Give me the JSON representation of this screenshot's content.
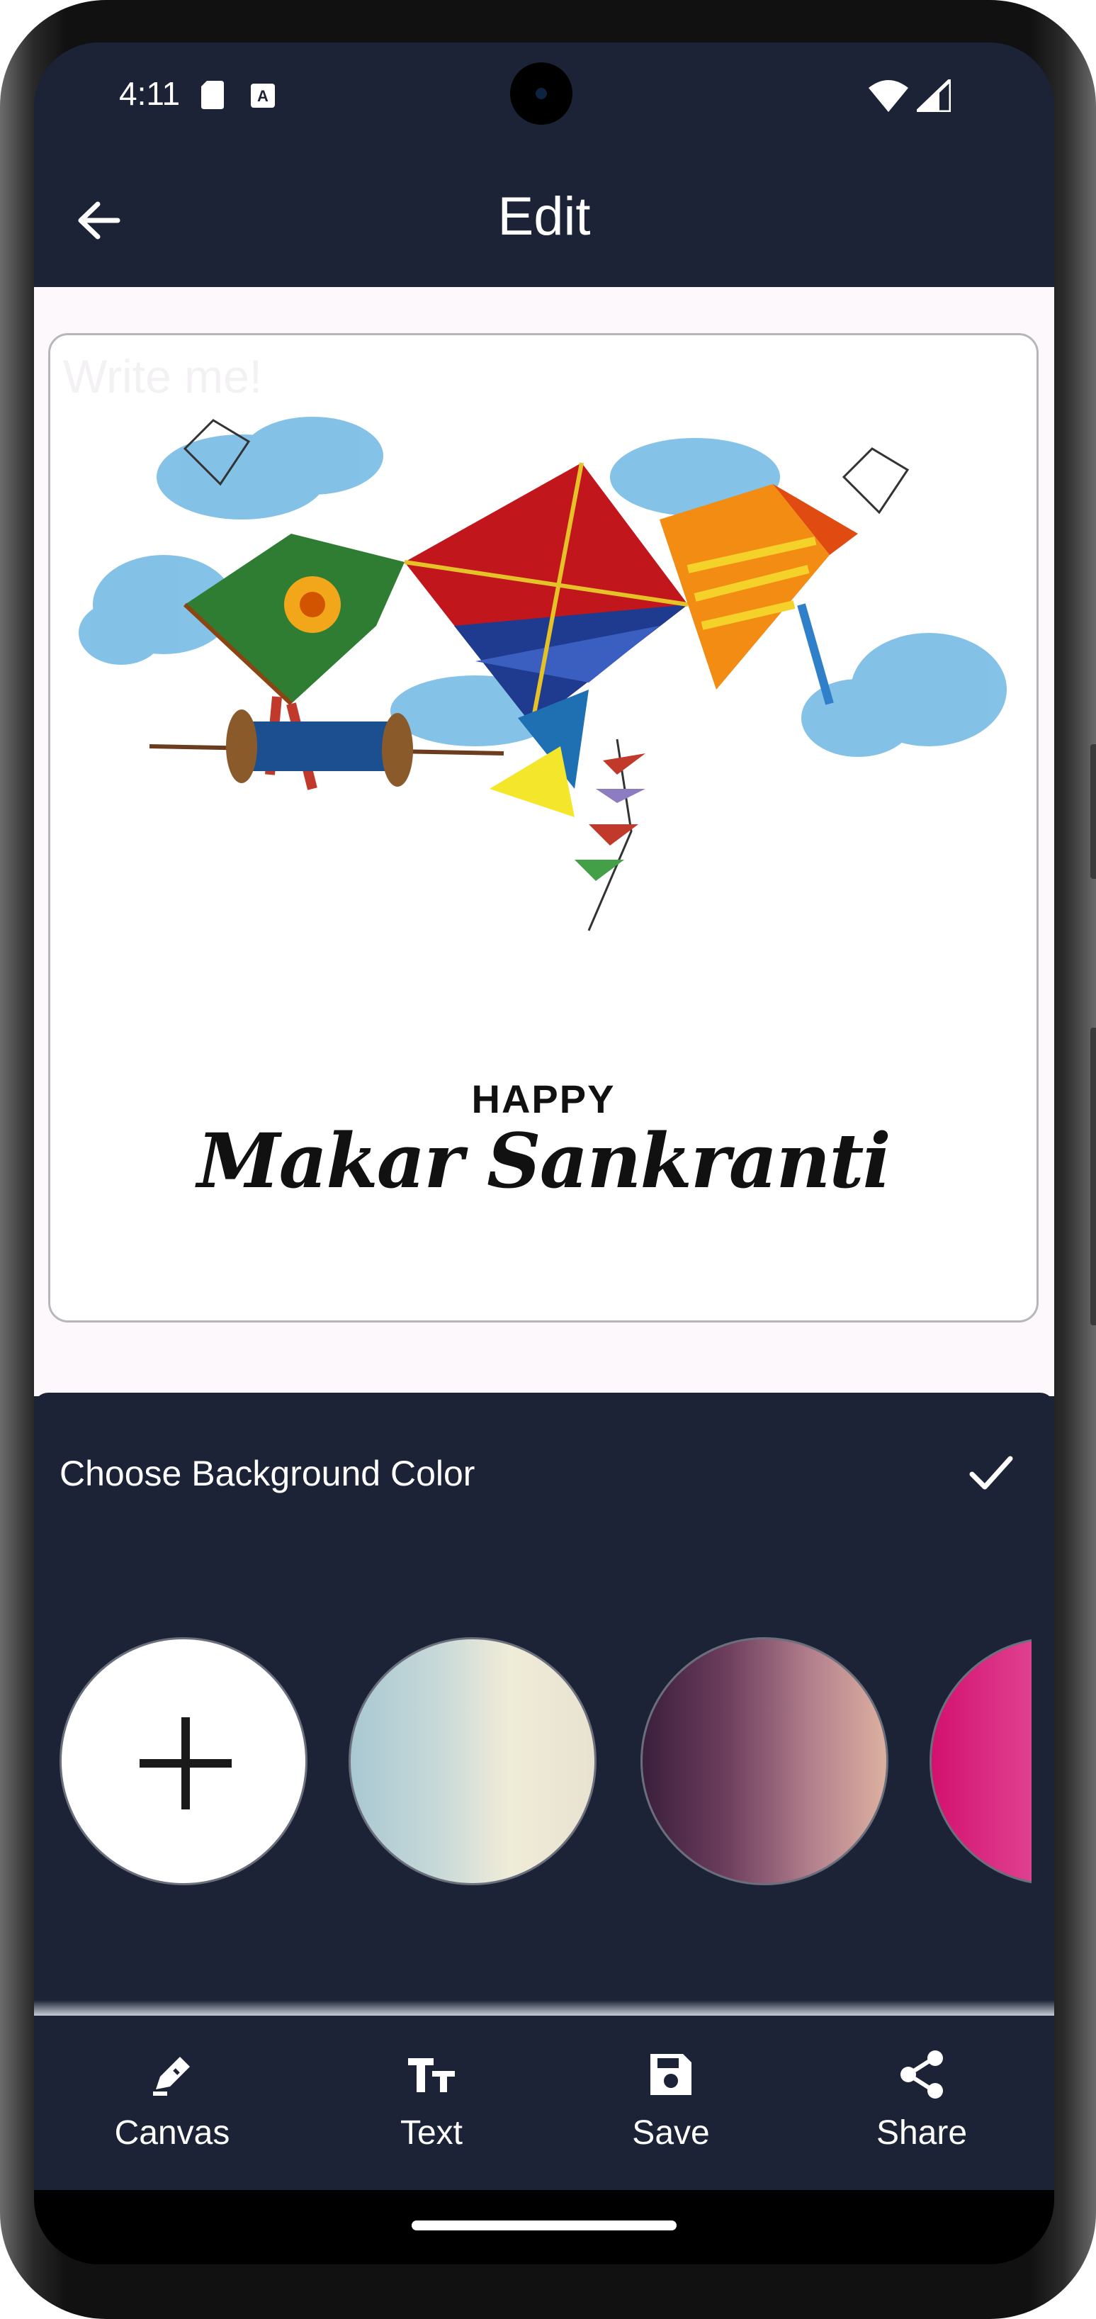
{
  "status_bar": {
    "time": "4:11"
  },
  "app_bar": {
    "title": "Edit"
  },
  "canvas": {
    "faint_placeholder": "Write me!",
    "greeting_line1": "HAPPY",
    "greeting_line2": "Makar Sankranti"
  },
  "background_picker": {
    "title": "Choose Background Color",
    "swatches": [
      {
        "type": "add",
        "color": "#ffffff"
      },
      {
        "type": "gradient",
        "colors": [
          "#a9c8d2",
          "#efecd8"
        ]
      },
      {
        "type": "gradient",
        "colors": [
          "#3a1f3c",
          "#dcb0a0"
        ]
      },
      {
        "type": "gradient",
        "colors": [
          "#d3116f",
          "#d070b8"
        ]
      }
    ]
  },
  "bottom_nav": {
    "items": [
      {
        "label": "Canvas",
        "icon": "pencil-edit-icon"
      },
      {
        "label": "Text",
        "icon": "text-size-icon"
      },
      {
        "label": "Save",
        "icon": "floppy-disk-icon"
      },
      {
        "label": "Share",
        "icon": "share-icon"
      }
    ]
  },
  "colors": {
    "bar_background": "#1c2336",
    "canvas_background": "#fdf8fc",
    "text_on_dark": "#ffffff"
  }
}
